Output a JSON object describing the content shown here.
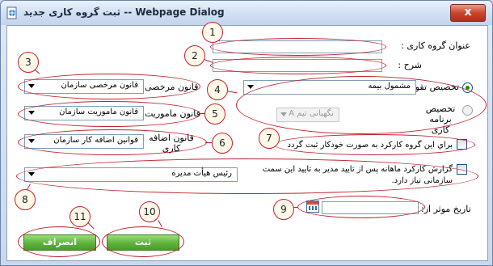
{
  "window": {
    "title": "ثبت گروه کاری جدید -- Webpage Dialog",
    "close_label": "x"
  },
  "form": {
    "group_title_label": "عنوان گروه کاری :",
    "group_title_value": "",
    "description_label": "شرح :",
    "description_value": "",
    "leave_rule_label": "قانون مرخصی",
    "leave_rule_value": "قانون مرخصی سازمان",
    "mission_rule_label": "قانون ماموریت",
    "mission_rule_value": "قانون ماموریت سازمان",
    "overtime_rule_label": "قانون اضافه کاری",
    "overtime_rule_value": "قوانین اضافه کار سازمان",
    "assign_calendar_label": "تخصیص تقویم",
    "calendar_value": "مشمول بیمه",
    "assign_program_label": "تخصیص برنامه کاری",
    "program_value": "نگهبانی تیم A",
    "auto_record_label": "براي اين گروه كاركرد به صورت خودكار ثبت گردد",
    "monthly_report_label": "گزارش کارکرد ماهانه پس از تایید مدیر به تایید این سمت سازمانی نیاز دارد.",
    "approver_value": "رئیس هیأت مدیره",
    "effective_date_label": "تاریخ موثر از:",
    "effective_date_value": ""
  },
  "buttons": {
    "submit_label": "ثبت",
    "cancel_label": "انصراف"
  },
  "callouts": [
    "1",
    "2",
    "3",
    "4",
    "5",
    "6",
    "7",
    "8",
    "9",
    "10",
    "11"
  ],
  "colors": {
    "callout": "#c0222d",
    "button_green": "#5fb23c",
    "radio_selected": "#1e8a1e"
  }
}
